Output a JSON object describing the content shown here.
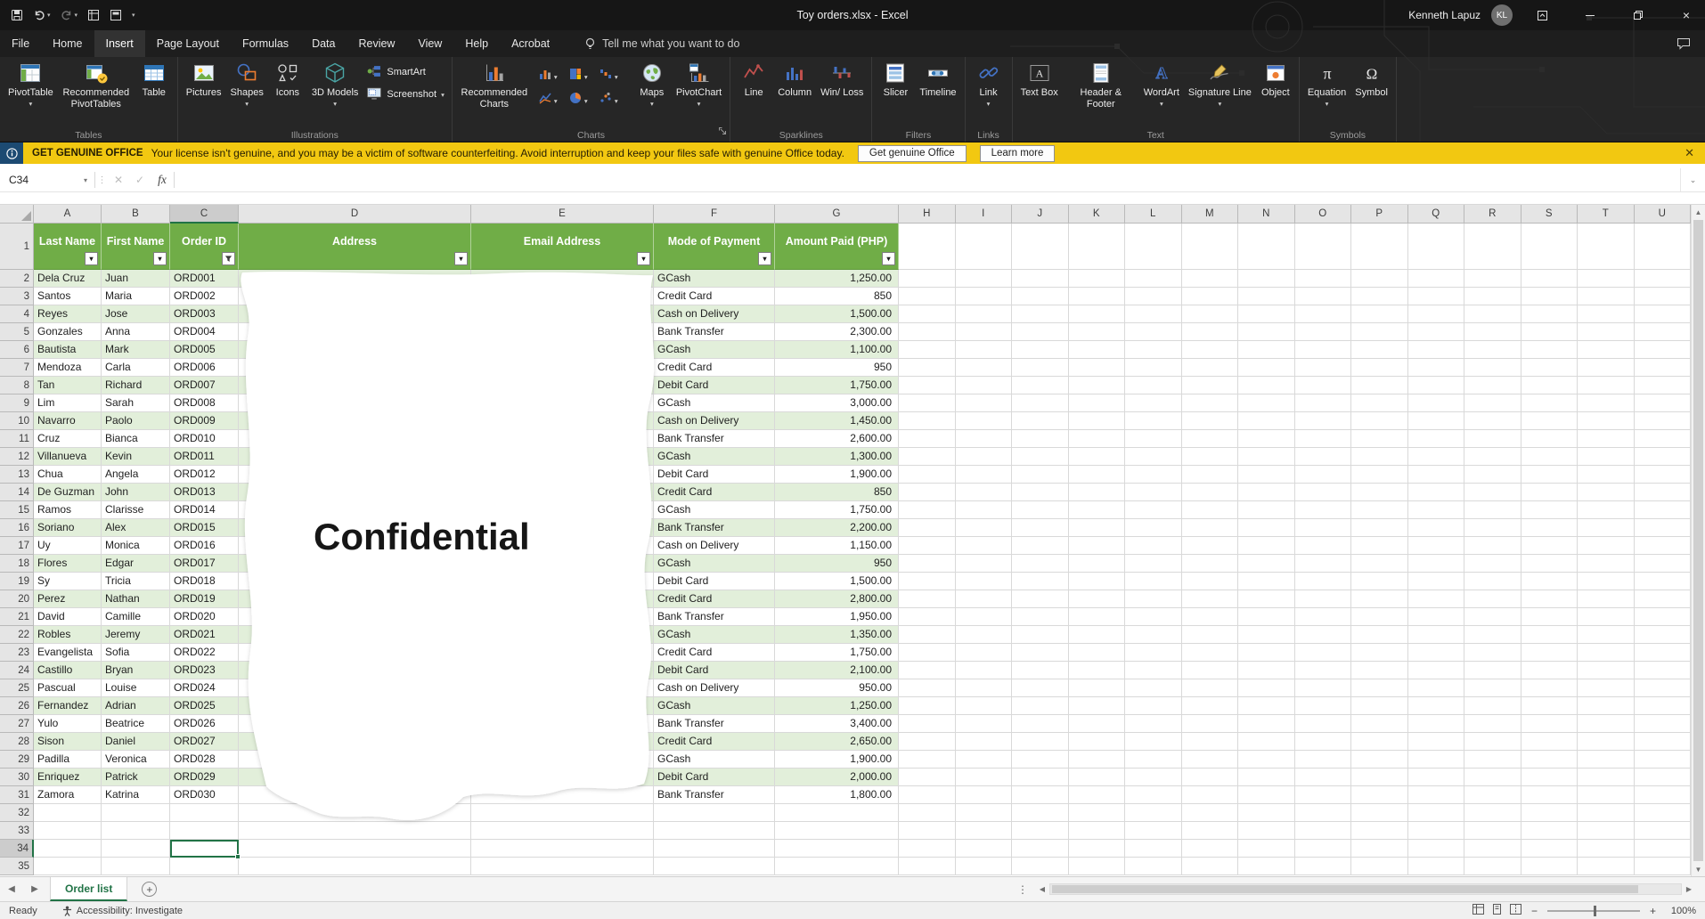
{
  "colors": {
    "table_header": "#70AD47",
    "band": "#E2EFDA",
    "selection": "#217346",
    "notice_bg": "#F2C811"
  },
  "titlebar": {
    "title": "Toy orders.xlsx - Excel",
    "user_name": "Kenneth Lapuz",
    "user_initials": "KL"
  },
  "menubar": {
    "tabs": [
      "File",
      "Home",
      "Insert",
      "Page Layout",
      "Formulas",
      "Data",
      "Review",
      "View",
      "Help",
      "Acrobat"
    ],
    "active_tab": "Insert",
    "tell_me": "Tell me what you want to do"
  },
  "ribbon": {
    "groups": [
      {
        "label": "Tables",
        "items": [
          {
            "label": "PivotTable",
            "icon": "pivottable-icon",
            "size": "large",
            "dropdown": true
          },
          {
            "label": "Recommended PivotTables",
            "icon": "recommended-pivottables-icon",
            "size": "large",
            "dropdown": false
          },
          {
            "label": "Table",
            "icon": "table-icon",
            "size": "large",
            "dropdown": false
          }
        ]
      },
      {
        "label": "Illustrations",
        "items": [
          {
            "label": "Pictures",
            "icon": "pictures-icon",
            "size": "large",
            "dropdown": false
          },
          {
            "label": "Shapes",
            "icon": "shapes-icon",
            "size": "large",
            "dropdown": true
          },
          {
            "label": "Icons",
            "icon": "icons-icon",
            "size": "large",
            "dropdown": false
          },
          {
            "label": "3D Models",
            "icon": "3d-models-icon",
            "size": "large",
            "dropdown": true
          },
          {
            "label": "SmartArt",
            "icon": "smartart-icon",
            "size": "small",
            "dropdown": false
          },
          {
            "label": "Screenshot",
            "icon": "screenshot-icon",
            "size": "small",
            "dropdown": true
          }
        ]
      },
      {
        "label": "Charts",
        "dialog_launcher": true,
        "items": [
          {
            "label": "Recommended Charts",
            "icon": "recommended-charts-icon",
            "size": "large",
            "dropdown": false
          },
          {
            "label": "",
            "icon": "chart-column-icon",
            "size": "mini",
            "dropdown": true
          },
          {
            "label": "",
            "icon": "chart-hierarchy-icon",
            "size": "mini",
            "dropdown": true
          },
          {
            "label": "",
            "icon": "chart-waterfall-icon",
            "size": "mini",
            "dropdown": true
          },
          {
            "label": "",
            "icon": "chart-line-icon",
            "size": "mini",
            "dropdown": true
          },
          {
            "label": "",
            "icon": "chart-pie-icon",
            "size": "mini",
            "dropdown": true
          },
          {
            "label": "",
            "icon": "chart-scatter-icon",
            "size": "mini",
            "dropdown": true
          },
          {
            "label": "Maps",
            "icon": "maps-icon",
            "size": "large",
            "dropdown": true
          },
          {
            "label": "PivotChart",
            "icon": "pivotchart-icon",
            "size": "large",
            "dropdown": true
          }
        ]
      },
      {
        "label": "Sparklines",
        "items": [
          {
            "label": "Line",
            "icon": "sparkline-line-icon",
            "size": "large",
            "dropdown": false
          },
          {
            "label": "Column",
            "icon": "sparkline-column-icon",
            "size": "large",
            "dropdown": false
          },
          {
            "label": "Win/ Loss",
            "icon": "sparkline-winloss-icon",
            "size": "large",
            "dropdown": false
          }
        ]
      },
      {
        "label": "Filters",
        "items": [
          {
            "label": "Slicer",
            "icon": "slicer-icon",
            "size": "large",
            "dropdown": false
          },
          {
            "label": "Timeline",
            "icon": "timeline-icon",
            "size": "large",
            "dropdown": false
          }
        ]
      },
      {
        "label": "Links",
        "items": [
          {
            "label": "Link",
            "icon": "link-icon",
            "size": "large",
            "dropdown": true
          }
        ]
      },
      {
        "label": "Text",
        "items": [
          {
            "label": "Text Box",
            "icon": "textbox-icon",
            "size": "large",
            "dropdown": false
          },
          {
            "label": "Header & Footer",
            "icon": "headerfooter-icon",
            "size": "large",
            "dropdown": false
          },
          {
            "label": "WordArt",
            "icon": "wordart-icon",
            "size": "large",
            "dropdown": true
          },
          {
            "label": "Signature Line",
            "icon": "signature-line-icon",
            "size": "large",
            "dropdown": true
          },
          {
            "label": "Object",
            "icon": "object-icon",
            "size": "large",
            "dropdown": false
          }
        ]
      },
      {
        "label": "Symbols",
        "items": [
          {
            "label": "Equation",
            "icon": "equation-icon",
            "size": "large",
            "dropdown": true
          },
          {
            "label": "Symbol",
            "icon": "symbol-icon",
            "size": "large",
            "dropdown": false
          }
        ]
      }
    ]
  },
  "notice": {
    "heading": "GET GENUINE OFFICE",
    "message": "Your license isn't genuine, and you may be a victim of software counterfeiting. Avoid interruption and keep your files safe with genuine Office today.",
    "primary_button": "Get genuine Office",
    "secondary_button": "Learn more"
  },
  "formula_bar": {
    "name_box": "C34",
    "function_label": "fx",
    "formula_value": ""
  },
  "sheet": {
    "col_letters": [
      "A",
      "B",
      "C",
      "D",
      "E",
      "F",
      "G",
      "H",
      "I",
      "J",
      "K",
      "L",
      "M",
      "N",
      "O",
      "P",
      "Q",
      "R",
      "S",
      "T",
      "U"
    ],
    "row_count": 35,
    "selected_cell": "C34",
    "selected_col": "C",
    "selected_row": 34,
    "watermark": "Confidential",
    "table": {
      "headers": [
        "Last Name",
        "First Name",
        "Order ID",
        "Address",
        "Email Address",
        "Mode of Payment",
        "Amount Paid (PHP)"
      ],
      "rows": [
        [
          "Dela Cruz",
          "Juan",
          "ORD001",
          "GCash",
          "1,250.00"
        ],
        [
          "Santos",
          "Maria",
          "ORD002",
          "Credit Card",
          "850"
        ],
        [
          "Reyes",
          "Jose",
          "ORD003",
          "Cash on Delivery",
          "1,500.00"
        ],
        [
          "Gonzales",
          "Anna",
          "ORD004",
          "Bank Transfer",
          "2,300.00"
        ],
        [
          "Bautista",
          "Mark",
          "ORD005",
          "GCash",
          "1,100.00"
        ],
        [
          "Mendoza",
          "Carla",
          "ORD006",
          "Credit Card",
          "950"
        ],
        [
          "Tan",
          "Richard",
          "ORD007",
          "Debit Card",
          "1,750.00"
        ],
        [
          "Lim",
          "Sarah",
          "ORD008",
          "GCash",
          "3,000.00"
        ],
        [
          "Navarro",
          "Paolo",
          "ORD009",
          "Cash on Delivery",
          "1,450.00"
        ],
        [
          "Cruz",
          "Bianca",
          "ORD010",
          "Bank Transfer",
          "2,600.00"
        ],
        [
          "Villanueva",
          "Kevin",
          "ORD011",
          "GCash",
          "1,300.00"
        ],
        [
          "Chua",
          "Angela",
          "ORD012",
          "Debit Card",
          "1,900.00"
        ],
        [
          "De Guzman",
          "John",
          "ORD013",
          "Credit Card",
          "850"
        ],
        [
          "Ramos",
          "Clarisse",
          "ORD014",
          "GCash",
          "1,750.00"
        ],
        [
          "Soriano",
          "Alex",
          "ORD015",
          "Bank Transfer",
          "2,200.00"
        ],
        [
          "Uy",
          "Monica",
          "ORD016",
          "Cash on Delivery",
          "1,150.00"
        ],
        [
          "Flores",
          "Edgar",
          "ORD017",
          "GCash",
          "950"
        ],
        [
          "Sy",
          "Tricia",
          "ORD018",
          "Debit Card",
          "1,500.00"
        ],
        [
          "Perez",
          "Nathan",
          "ORD019",
          "Credit Card",
          "2,800.00"
        ],
        [
          "David",
          "Camille",
          "ORD020",
          "Bank Transfer",
          "1,950.00"
        ],
        [
          "Robles",
          "Jeremy",
          "ORD021",
          "GCash",
          "1,350.00"
        ],
        [
          "Evangelista",
          "Sofia",
          "ORD022",
          "Credit Card",
          "1,750.00"
        ],
        [
          "Castillo",
          "Bryan",
          "ORD023",
          "Debit Card",
          "2,100.00"
        ],
        [
          "Pascual",
          "Louise",
          "ORD024",
          "Cash on Delivery",
          "950.00"
        ],
        [
          "Fernandez",
          "Adrian",
          "ORD025",
          "GCash",
          "1,250.00"
        ],
        [
          "Yulo",
          "Beatrice",
          "ORD026",
          "Bank Transfer",
          "3,400.00"
        ],
        [
          "Sison",
          "Daniel",
          "ORD027",
          "Credit Card",
          "2,650.00"
        ],
        [
          "Padilla",
          "Veronica",
          "ORD028",
          "GCash",
          "1,900.00"
        ],
        [
          "Enriquez",
          "Patrick",
          "ORD029",
          "Debit Card",
          "2,000.00"
        ],
        [
          "Zamora",
          "Katrina",
          "ORD030",
          "Bank Transfer",
          "1,800.00"
        ]
      ]
    }
  },
  "sheet_bar": {
    "active_tab": "Order list"
  },
  "status_bar": {
    "mode": "Ready",
    "accessibility": "Accessibility: Investigate",
    "zoom": "100%"
  }
}
